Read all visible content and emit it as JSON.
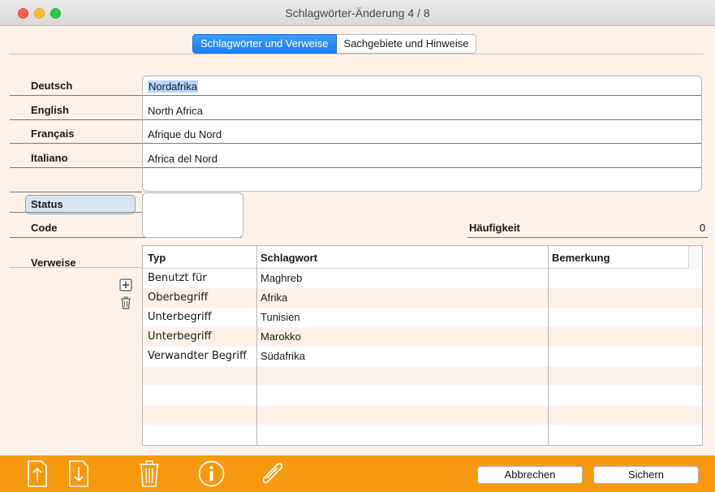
{
  "window": {
    "title": "Schlagwörter-Änderung  4 / 8"
  },
  "tabs": [
    {
      "label": "Schlagwörter und Verweise",
      "active": true
    },
    {
      "label": "Sachgebiete und Hinweise",
      "active": false
    }
  ],
  "languages": [
    {
      "label": "Deutsch",
      "value": "Nordafrika"
    },
    {
      "label": "English",
      "value": "North Africa"
    },
    {
      "label": "Français",
      "value": "Afrique du Nord"
    },
    {
      "label": "Italiano",
      "value": "Africa del Nord"
    }
  ],
  "status": {
    "label": "Status",
    "value": ""
  },
  "code": {
    "label": "Code",
    "value": ""
  },
  "haeufigkeit": {
    "label": "Häufigkeit",
    "value": "0"
  },
  "verweise": {
    "label": "Verweise",
    "columns": [
      "Typ",
      "Schlagwort",
      "Bemerkung"
    ],
    "rows": [
      {
        "typ": "Benutzt für",
        "schlagwort": "Maghreb",
        "bemerkung": ""
      },
      {
        "typ": "Oberbegriff",
        "schlagwort": "Afrika",
        "bemerkung": ""
      },
      {
        "typ": "Unterbegriff",
        "schlagwort": "Tunisien",
        "bemerkung": ""
      },
      {
        "typ": "Unterbegriff",
        "schlagwort": "Marokko",
        "bemerkung": ""
      },
      {
        "typ": "Verwandter Begriff",
        "schlagwort": "Südafrika",
        "bemerkung": ""
      }
    ]
  },
  "buttons": {
    "cancel": "Abbrechen",
    "save": "Sichern"
  },
  "icons": {
    "add": "plus-icon",
    "delete": "trash-icon",
    "export": "upload-icon",
    "import": "download-icon",
    "info": "info-icon",
    "attach": "paperclip-icon"
  },
  "colors": {
    "accent": "#1b7ef2",
    "bottom_bar": "#f59a10",
    "content_bg": "#fdf2e9"
  }
}
